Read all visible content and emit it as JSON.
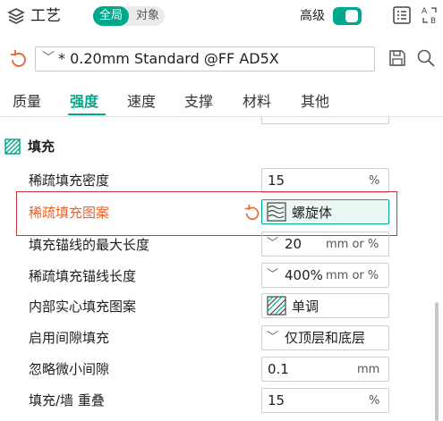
{
  "header": {
    "title": "工艺",
    "segment": {
      "active": "全局",
      "other": "对象"
    },
    "advanced_label": "高级",
    "advanced_on": true
  },
  "preset": {
    "value": "* 0.20mm Standard @FF AD5X"
  },
  "tabs": [
    {
      "label": "质量",
      "active": false
    },
    {
      "label": "强度",
      "active": true
    },
    {
      "label": "速度",
      "active": false
    },
    {
      "label": "支撑",
      "active": false
    },
    {
      "label": "材料",
      "active": false
    },
    {
      "label": "其他",
      "active": false
    }
  ],
  "section": {
    "title": "填充"
  },
  "rows": [
    {
      "label": "稀疏填充密度",
      "value": "15",
      "unit": "%"
    },
    {
      "label": "稀疏填充图案",
      "value": "螺旋体",
      "highlighted": true
    },
    {
      "label": "填充锚线的最大长度",
      "value": "20",
      "unit": "mm or %"
    },
    {
      "label": "稀疏填充锚线长度",
      "value": "400%",
      "unit": "mm or %"
    },
    {
      "label": "内部实心填充图案",
      "value": "单调"
    },
    {
      "label": "启用间隙填充",
      "value": "仅顶层和底层"
    },
    {
      "label": "忽略微小间隙",
      "value": "0.1",
      "unit": "mm"
    },
    {
      "label": "填充/墙 重叠",
      "value": "15",
      "unit": "%"
    }
  ],
  "colors": {
    "accent": "#00a88b",
    "highlight": "#c8383a",
    "modified": "#e8632a"
  }
}
